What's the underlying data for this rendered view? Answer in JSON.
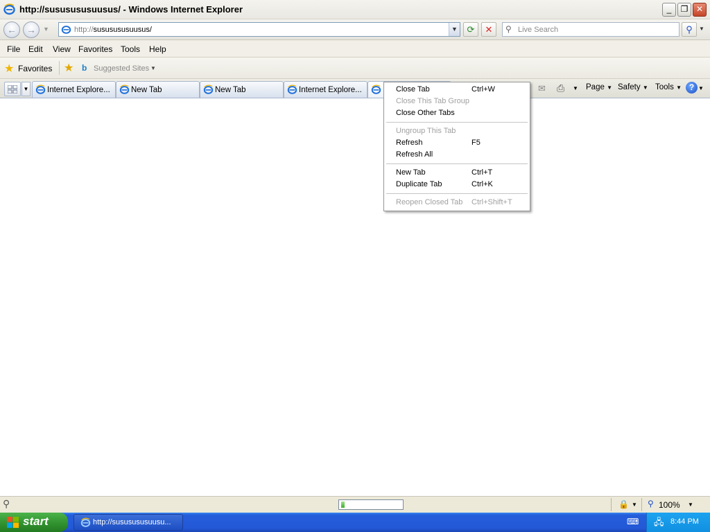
{
  "window": {
    "title": "http://sususususuusus/ - Windows Internet Explorer"
  },
  "navbar": {
    "address_protocol": "http://",
    "address_host": "sususususuusus/",
    "search_placeholder": "Live Search"
  },
  "menubar": {
    "items": [
      "File",
      "Edit",
      "View",
      "Favorites",
      "Tools",
      "Help"
    ]
  },
  "favbar": {
    "favorites_label": "Favorites",
    "suggested_sites_label": "Suggested Sites"
  },
  "tabs": [
    {
      "label": "Internet Explore..."
    },
    {
      "label": "New Tab"
    },
    {
      "label": "New Tab"
    },
    {
      "label": "Internet Explore..."
    },
    {
      "label": ""
    }
  ],
  "commandbar": {
    "page_label": "Page",
    "safety_label": "Safety",
    "tools_label": "Tools"
  },
  "context_menu": {
    "items": [
      {
        "label": "Close Tab",
        "shortcut": "Ctrl+W",
        "enabled": true
      },
      {
        "label": "Close This Tab Group",
        "shortcut": "",
        "enabled": false
      },
      {
        "label": "Close Other Tabs",
        "shortcut": "",
        "enabled": true
      },
      {
        "label": "Ungroup This Tab",
        "shortcut": "",
        "enabled": false
      },
      {
        "label": "Refresh",
        "shortcut": "F5",
        "enabled": true
      },
      {
        "label": "Refresh All",
        "shortcut": "",
        "enabled": true
      },
      {
        "label": "New Tab",
        "shortcut": "Ctrl+T",
        "enabled": true
      },
      {
        "label": "Duplicate Tab",
        "shortcut": "Ctrl+K",
        "enabled": true
      },
      {
        "label": "Reopen Closed Tab",
        "shortcut": "Ctrl+Shift+T",
        "enabled": false
      }
    ]
  },
  "statusbar": {
    "zoom_label": "100%",
    "progress_fraction": 0.06
  },
  "taskbar": {
    "start_label": "start",
    "task_label": "http://sususususuusu...",
    "clock": "8:44 PM"
  },
  "colors": {
    "taskbar_blue": "#245edb",
    "start_green": "#2f8f2d",
    "tray_blue": "#118fe0"
  }
}
